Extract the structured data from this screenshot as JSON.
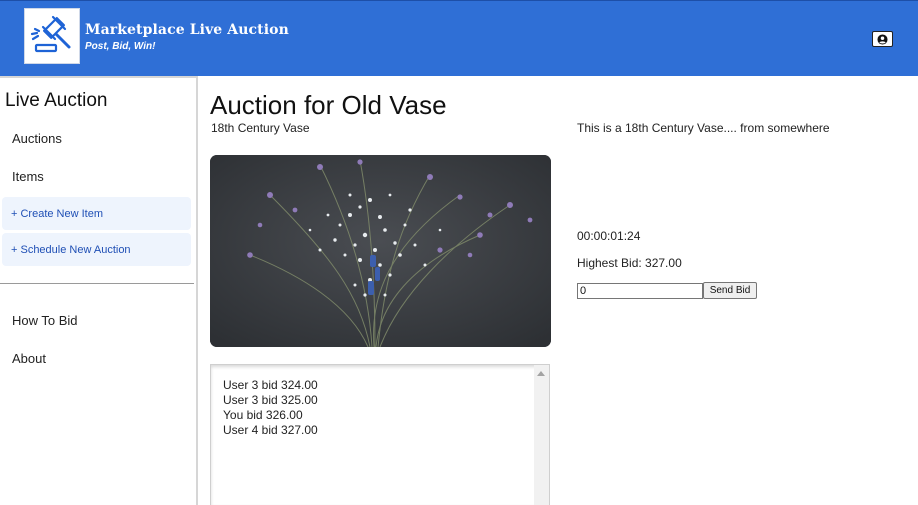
{
  "header": {
    "title": "Marketplace Live Auction",
    "tagline": "Post, Bid, Win!",
    "logo_icon": "gavel-icon",
    "account_icon": "user-circle-icon",
    "background_color": "#2f6fd6"
  },
  "sidebar": {
    "title": "Live Auction",
    "items": [
      {
        "label": "Auctions"
      },
      {
        "label": "Items"
      }
    ],
    "actions": [
      {
        "label": "+ Create New Item"
      },
      {
        "label": "+ Schedule New Auction"
      }
    ],
    "footer_items": [
      {
        "label": "How To Bid"
      },
      {
        "label": "About"
      }
    ],
    "action_color": "#1f4fb5"
  },
  "auction": {
    "title": "Auction for Old Vase",
    "item_name": "18th Century Vase",
    "description": "This is a 18th Century Vase.... from somewhere",
    "timer": "00:00:01:24",
    "highest_bid": "Highest Bid: 327.00",
    "bid_value": "0",
    "send_label": "Send Bid"
  },
  "bid_log": [
    "User 3 bid 324.00",
    "User 3 bid 325.00",
    "You bid 326.00",
    "User 4 bid 327.00"
  ]
}
